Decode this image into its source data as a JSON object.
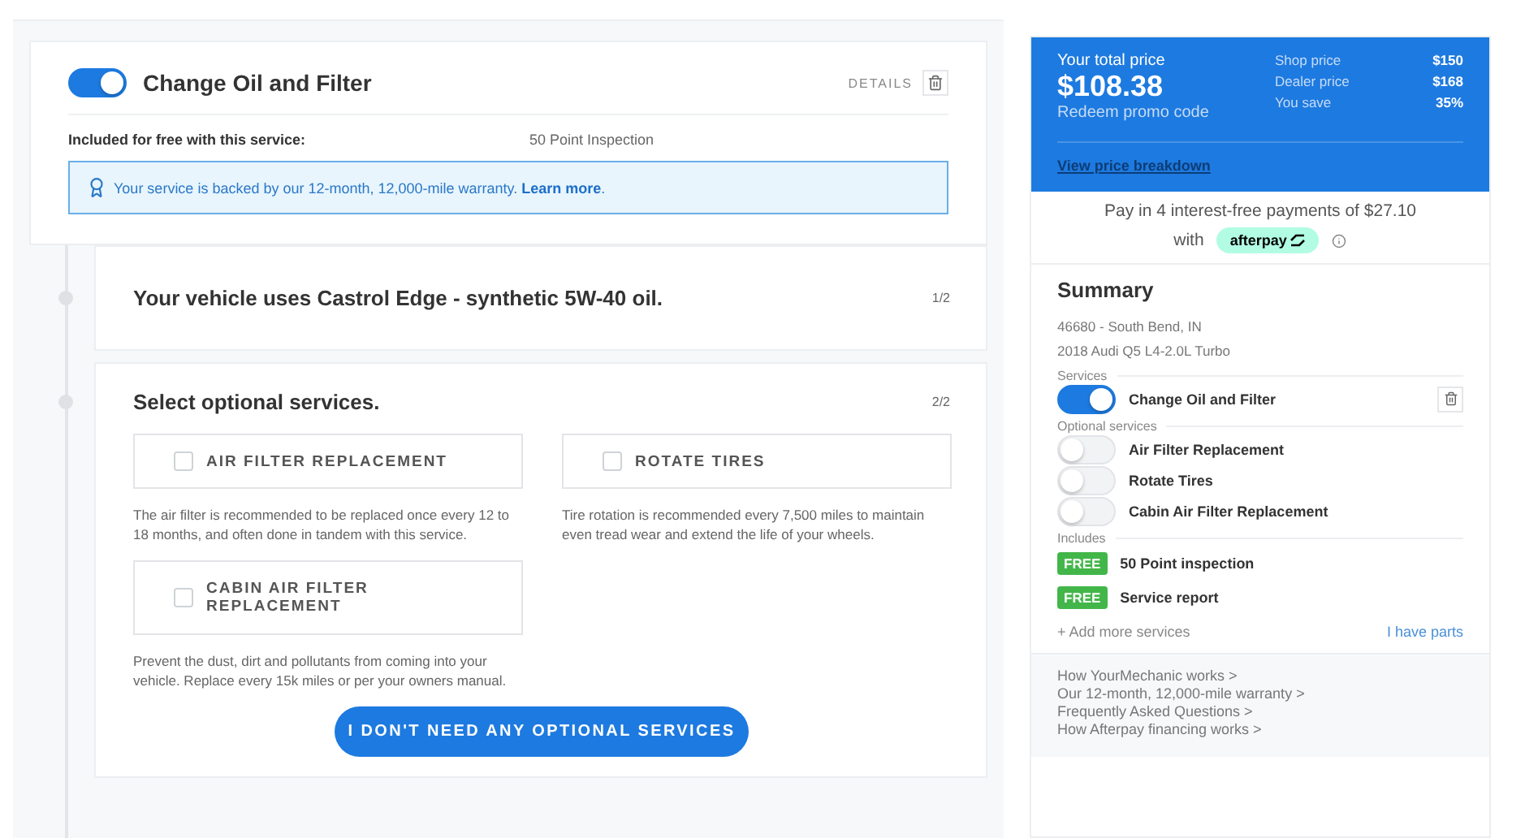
{
  "service": {
    "title": "Change Oil and Filter",
    "on": true,
    "details": "DETAILS",
    "included_label": "Included for free with this service:",
    "included_value": "50 Point Inspection",
    "warranty": {
      "text": "Your service is backed by our 12-month, 12,000-mile warranty.",
      "link": "Learn more",
      "end": "."
    }
  },
  "steps": [
    {
      "kind": "info",
      "title": "Your vehicle uses Castrol Edge - synthetic 5W-40 oil.",
      "counter": "1/2"
    },
    {
      "kind": "options",
      "title": "Select optional services.",
      "counter": "2/2",
      "options": [
        {
          "label": "AIR FILTER REPLACEMENT",
          "checked": false,
          "description": "The air filter is recommended to be replaced once every 12 to 18 months, and often done in tandem with this service."
        },
        {
          "label": "ROTATE TIRES",
          "checked": false,
          "description": "Tire rotation is recommended every 7,500 miles to maintain even tread wear and extend the life of your wheels."
        },
        {
          "label": "CABIN AIR FILTER REPLACEMENT",
          "checked": false,
          "description": "Prevent the dust, dirt and pollutants from coming into your vehicle. Replace every 15k miles or per your owners manual."
        }
      ],
      "button": "I DON'T NEED ANY OPTIONAL SERVICES"
    }
  ],
  "price": {
    "total_label": "Your total price",
    "total": "$108.38",
    "promo": "Redeem promo code",
    "rows": [
      {
        "label": "Shop price",
        "value": "$150"
      },
      {
        "label": "Dealer price",
        "value": "$168"
      },
      {
        "label": "You save",
        "value": "35%"
      }
    ],
    "breakdown": "View price breakdown"
  },
  "afterpay": {
    "text": "Pay in 4 interest-free payments of $27.10",
    "with": "with",
    "brand": "afterpay"
  },
  "summary": {
    "title": "Summary",
    "location": "46680 - South Bend, IN",
    "vehicle": "2018 Audi Q5 L4-2.0L Turbo",
    "services_label": "Services",
    "services": [
      {
        "name": "Change Oil and Filter",
        "on": true
      }
    ],
    "optional_label": "Optional services",
    "optional": [
      {
        "name": "Air Filter Replacement",
        "on": false
      },
      {
        "name": "Rotate Tires",
        "on": false
      },
      {
        "name": "Cabin Air Filter Replacement",
        "on": false
      }
    ],
    "includes_label": "Includes",
    "includes": [
      {
        "badge": "FREE",
        "name": "50 Point inspection"
      },
      {
        "badge": "FREE",
        "name": "Service report"
      }
    ],
    "add_more": "+ Add more services",
    "have_parts": "I have parts"
  },
  "links": [
    "How YourMechanic works >",
    "Our 12-month, 12,000-mile warranty >",
    "Frequently Asked Questions >",
    "How Afterpay financing works >"
  ]
}
